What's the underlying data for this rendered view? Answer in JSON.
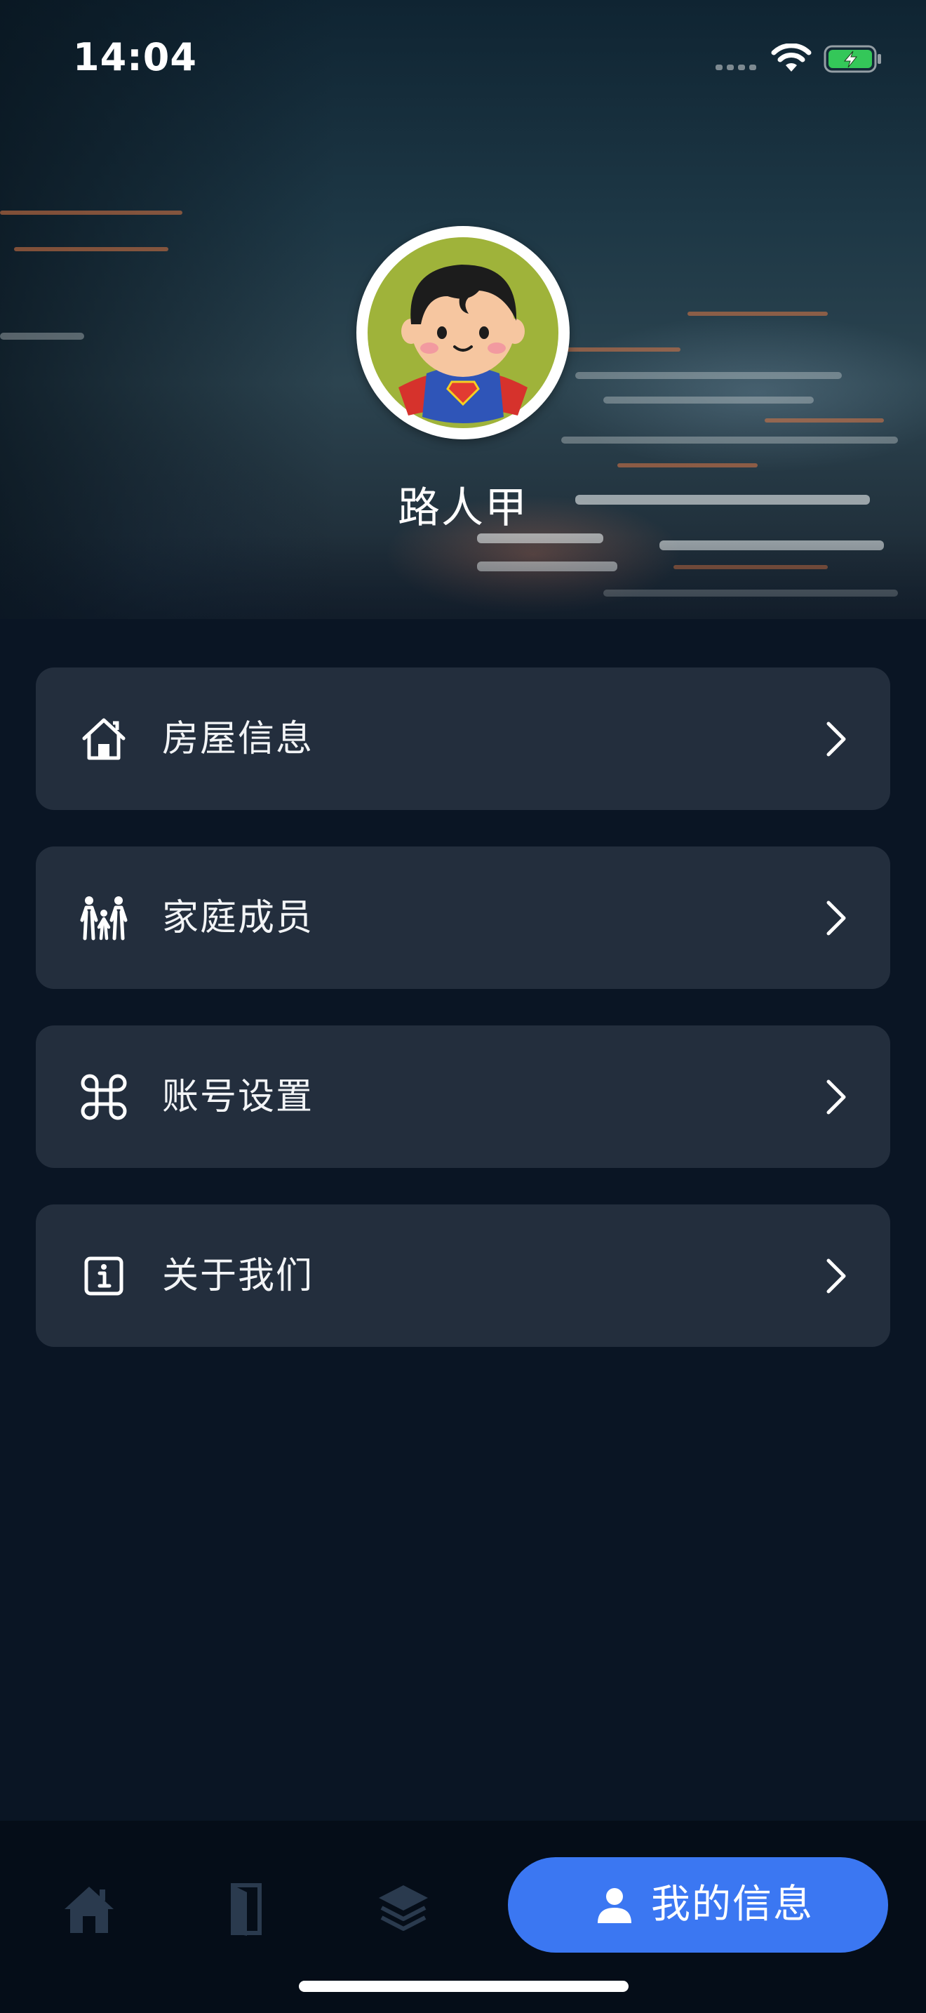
{
  "status_bar": {
    "time": "14:04"
  },
  "profile": {
    "name": "路人甲"
  },
  "menu": [
    {
      "label": "房屋信息",
      "icon": "house-icon"
    },
    {
      "label": "家庭成员",
      "icon": "family-icon"
    },
    {
      "label": "账号设置",
      "icon": "command-icon"
    },
    {
      "label": "关于我们",
      "icon": "info-icon"
    }
  ],
  "tabbar": {
    "tabs": [
      {
        "icon": "home-icon"
      },
      {
        "icon": "door-icon"
      },
      {
        "icon": "layers-icon"
      }
    ],
    "active": {
      "label": "我的信息",
      "icon": "user-icon"
    }
  },
  "colors": {
    "accent": "#3b77f2",
    "card": "#232e3d",
    "background": "#0a1524",
    "battery": "#34c759"
  }
}
